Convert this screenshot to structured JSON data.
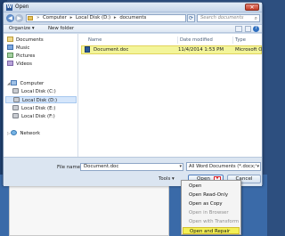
{
  "window": {
    "title": "Open"
  },
  "address": {
    "crumbs": [
      "Computer",
      "Local Disk (D:)",
      "documents"
    ]
  },
  "search": {
    "placeholder": "Search documents"
  },
  "toolbar": {
    "organize": "Organize ▾",
    "new_folder": "New folder"
  },
  "nav": {
    "items": [
      {
        "label": "Documents",
        "icon": "documents-library-icon"
      },
      {
        "label": "Music",
        "icon": "music-library-icon"
      },
      {
        "label": "Pictures",
        "icon": "pictures-library-icon"
      },
      {
        "label": "Videos",
        "icon": "videos-library-icon"
      },
      {
        "label": "Computer",
        "icon": "computer-icon"
      },
      {
        "label": "Local Disk (C:)",
        "icon": "disk-icon"
      },
      {
        "label": "Local Disk (D:)",
        "icon": "disk-icon"
      },
      {
        "label": "Local Disk (E:)",
        "icon": "disk-icon"
      },
      {
        "label": "Local Disk (F:)",
        "icon": "disk-icon"
      },
      {
        "label": "Network",
        "icon": "network-icon"
      }
    ]
  },
  "files": {
    "headers": [
      "Name",
      "Date modified",
      "Type"
    ],
    "rows": [
      {
        "name": "Document.doc",
        "date": "11/4/2014 1:53 PM",
        "type": "Microsoft Office"
      }
    ]
  },
  "bottom": {
    "file_name_label": "File name:",
    "file_name_value": "Document.doc",
    "file_type": "All Word Documents (*.docx;*.",
    "tools": "Tools",
    "open": "Open",
    "cancel": "Cancel"
  },
  "open_menu": {
    "items": [
      {
        "label": "Open",
        "disabled": false
      },
      {
        "label": "Open Read-Only",
        "disabled": false
      },
      {
        "label": "Open as Copy",
        "disabled": false
      },
      {
        "label": "Open in Browser",
        "disabled": true
      },
      {
        "label": "Open with Transform",
        "disabled": true
      },
      {
        "label": "Open and Repair",
        "disabled": false,
        "highlighted": true
      }
    ]
  },
  "colors": {
    "highlight": "#f3f056",
    "accent_red": "#d7232b",
    "selection": "#d5e6fb"
  }
}
